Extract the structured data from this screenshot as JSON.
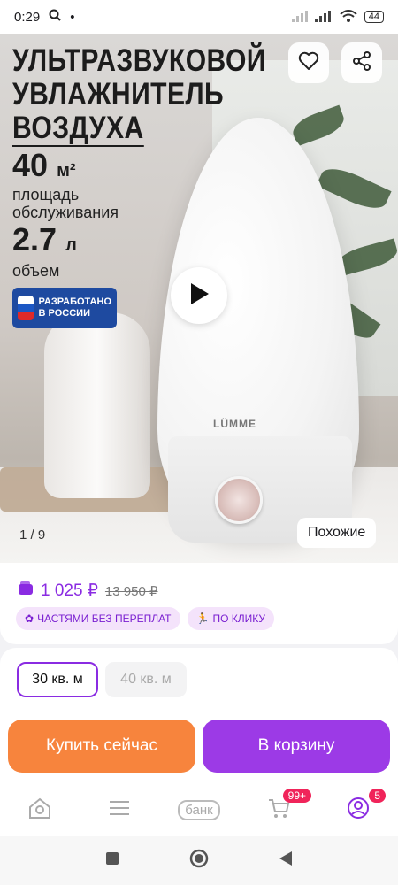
{
  "status_bar": {
    "time": "0:29",
    "battery": "44"
  },
  "hero": {
    "title_lines": [
      "УЛЬТРАЗВУКОВОЙ",
      "УВЛАЖНИТЕЛЬ",
      "ВОЗДУХА"
    ],
    "area_value": "40",
    "area_unit": "м²",
    "area_label": "площадь обслуживания",
    "volume_value": "2.7",
    "volume_unit": "л",
    "volume_label": "объем",
    "badge_line1": "РАЗРАБОТАНО",
    "badge_line2": "В РОССИИ",
    "brand": "LÜMME",
    "counter": "1 / 9",
    "similar_label": "Похожие"
  },
  "price": {
    "current": "1 025 ₽",
    "old": "13 950 ₽",
    "tags": [
      "ЧАСТЯМИ БЕЗ ПЕРЕПЛАТ",
      "ПО КЛИКУ"
    ]
  },
  "sizes": {
    "selected": "30 кв. м",
    "unavailable": "40 кв. м"
  },
  "actions": {
    "buy_now": "Купить сейчас",
    "add_to_cart": "В корзину"
  },
  "bottom_nav": {
    "bank_label": "банк",
    "cart_badge": "99+",
    "profile_badge": "5"
  },
  "colors": {
    "accent": "#8a2be2",
    "buy": "#f7843d",
    "cart": "#9c3ae6",
    "badge": "#f0245a"
  }
}
